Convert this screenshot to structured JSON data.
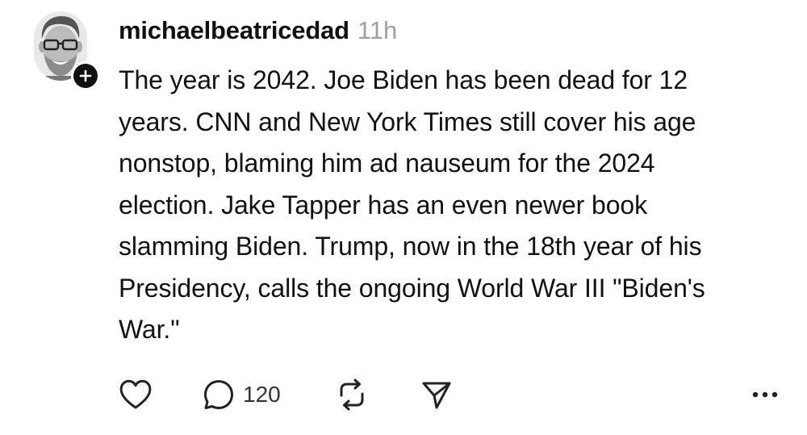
{
  "post": {
    "author": {
      "username": "michaelbeatricedad",
      "avatar_icon": "user-avatar",
      "follow_icon": "plus-icon"
    },
    "timestamp": "11h",
    "text": "The year is 2042. Joe Biden has been dead for 12\nyears. CNN and New York Times still cover his age\nnonstop, blaming him ad nauseum for the 2024\nelection. Jake Tapper has an even newer book\nslamming Biden. Trump, now in the 18th year of his\nPresidency, calls the ongoing World War III \"Biden's\nWar.\"",
    "actions": {
      "like_icon": "heart-icon",
      "reply_icon": "speech-bubble-icon",
      "reply_count": "120",
      "repost_icon": "repost-icon",
      "share_icon": "paper-plane-icon",
      "more_icon": "ellipsis-icon"
    }
  },
  "colors": {
    "text": "#111111",
    "muted": "#a0a0a0",
    "icon": "#222222",
    "background": "#ffffff"
  }
}
